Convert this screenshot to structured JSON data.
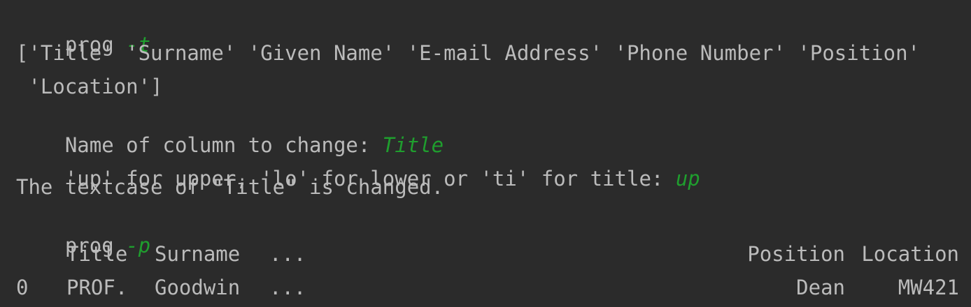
{
  "console": {
    "line1": {
      "prompt": "prog ",
      "input": "-t"
    },
    "line2": {
      "text": "['Title' 'Surname' 'Given Name' 'E-mail Address' 'Phone Number' 'Position'"
    },
    "line3": {
      "text": " 'Location']"
    },
    "line4": {
      "prompt": "Name of column to change: ",
      "input": "Title"
    },
    "line5": {
      "prompt": "'up' for upper, 'lo' for lower or 'ti' for title: ",
      "input": "up"
    },
    "line6": {
      "text": "The textcase of \"Title\" is changed."
    },
    "line7": {
      "prompt": "prog ",
      "input": "-p"
    },
    "table": {
      "headers": {
        "title": "Title",
        "surname": "Surname",
        "ellipsis": "...",
        "position": "Position",
        "location": "Location"
      },
      "row0": {
        "index": "0",
        "title": "PROF.",
        "surname": "Goodwin",
        "ellipsis": "...",
        "position": "Dean",
        "location": "MW421"
      }
    }
  },
  "colors": {
    "background": "#2b2b2b",
    "text": "#bbbbbb",
    "input": "#1f9e2e"
  }
}
